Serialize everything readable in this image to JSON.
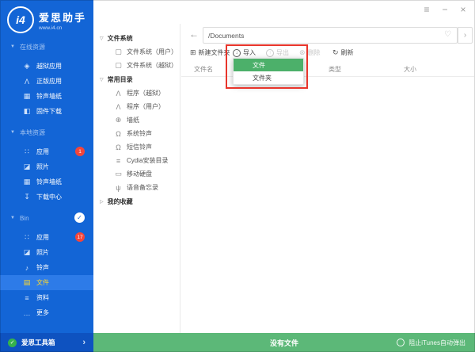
{
  "window": {
    "titlebar": {
      "menu_icon": "≡",
      "minimize_icon": "−",
      "close_icon": "×"
    }
  },
  "icons": {
    "chevron_down": "▼",
    "tree_open": "▽",
    "tree_closed": "▷",
    "check": "✓"
  },
  "colors": {
    "sidebar_blue": "#1365d6",
    "sidebar_selected": "#2d7be8",
    "selected_yellow": "#ffd92b",
    "footer_blue": "#0e52c0",
    "badge_red": "#f4453a",
    "dropdown_green": "#4cb06a",
    "statusbar_green": "#5cb878",
    "highlight_red": "#e8352b"
  },
  "sidebar": {
    "logo": {
      "badge_text": "i4",
      "title": "爱思助手",
      "subtitle": "www.i4.cn"
    },
    "sections": [
      {
        "label": "在线资源",
        "items": [
          {
            "icon": "jailbreak-apps-icon",
            "glyph": "◈",
            "label": "越狱应用"
          },
          {
            "icon": "genuine-apps-icon",
            "glyph": "Λ",
            "label": "正版应用"
          },
          {
            "icon": "ringtone-wallpaper-icon",
            "glyph": "▦",
            "label": "铃声墙纸"
          },
          {
            "icon": "firmware-download-icon",
            "glyph": "◧",
            "label": "固件下载"
          }
        ]
      },
      {
        "label": "本地资源",
        "items": [
          {
            "icon": "apps-icon",
            "glyph": "∷",
            "label": "应用",
            "badge": "1"
          },
          {
            "icon": "photos-icon",
            "glyph": "◪",
            "label": "照片"
          },
          {
            "icon": "ringtone-wallpaper-icon",
            "glyph": "▦",
            "label": "铃声墙纸"
          },
          {
            "icon": "download-center-icon",
            "glyph": "↧",
            "label": "下载中心"
          }
        ]
      },
      {
        "label": "Bin",
        "checked": true,
        "items": [
          {
            "icon": "apps-icon",
            "glyph": "∷",
            "label": "应用",
            "badge": "17"
          },
          {
            "icon": "photos-icon",
            "glyph": "◪",
            "label": "照片"
          },
          {
            "icon": "ringtone-icon",
            "glyph": "♪",
            "label": "铃声"
          },
          {
            "icon": "files-icon",
            "glyph": "▤",
            "label": "文件",
            "selected": true
          },
          {
            "icon": "data-icon",
            "glyph": "≡",
            "label": "资料"
          },
          {
            "icon": "more-icon",
            "glyph": "…",
            "label": "更多"
          }
        ]
      }
    ],
    "footer": {
      "label": "爱思工具箱",
      "arrow": "›"
    }
  },
  "tree": {
    "groups": [
      {
        "label": "文件系统",
        "children": [
          {
            "icon": "filesystem-icon",
            "glyph": "▢",
            "label": "文件系统（用户）"
          },
          {
            "icon": "filesystem-icon",
            "glyph": "▢",
            "label": "文件系统（越狱）"
          }
        ]
      },
      {
        "label": "常用目录",
        "children": [
          {
            "icon": "program-icon",
            "glyph": "Λ",
            "label": "程序（越狱）"
          },
          {
            "icon": "program-icon",
            "glyph": "Λ",
            "label": "程序（用户）"
          },
          {
            "icon": "wallpaper-icon",
            "glyph": "⊕",
            "label": "墙纸"
          },
          {
            "icon": "bell-icon",
            "glyph": "Ω",
            "label": "系统铃声"
          },
          {
            "icon": "bell-icon",
            "glyph": "Ω",
            "label": "短信铃声"
          },
          {
            "icon": "cydia-icon",
            "glyph": "≡",
            "label": "Cydia安装目录"
          },
          {
            "icon": "drive-icon",
            "glyph": "▭",
            "label": "移动硬盘"
          },
          {
            "icon": "voice-memo-icon",
            "glyph": "ψ",
            "label": "语音备忘录"
          }
        ]
      },
      {
        "label": "我的收藏",
        "children": []
      }
    ]
  },
  "main": {
    "pathbar": {
      "back_icon": "←",
      "path": "/Documents",
      "favorite_icon": "♡",
      "forward_icon": "›"
    },
    "toolbar": [
      {
        "icon": "new-folder-icon",
        "glyph": "⊞",
        "label": "新建文件夹",
        "enabled": true
      },
      {
        "icon": "import-icon",
        "glyph": "↓",
        "label": "导入",
        "enabled": true
      },
      {
        "icon": "export-icon",
        "glyph": "↑",
        "label": "导出",
        "enabled": false
      },
      {
        "icon": "delete-icon",
        "glyph": "⊗",
        "label": "删除",
        "enabled": false
      },
      {
        "icon": "refresh-icon",
        "glyph": "↻",
        "label": "刷新",
        "enabled": true
      }
    ],
    "columns": [
      "文件名",
      "类型",
      "大小"
    ],
    "dropdown": {
      "items": [
        {
          "label": "文件",
          "active": true
        },
        {
          "label": "文件夹",
          "active": false
        }
      ]
    }
  },
  "statusbar": {
    "empty_text": "没有文件",
    "toggle_label": "阻止iTunes自动弹出"
  }
}
